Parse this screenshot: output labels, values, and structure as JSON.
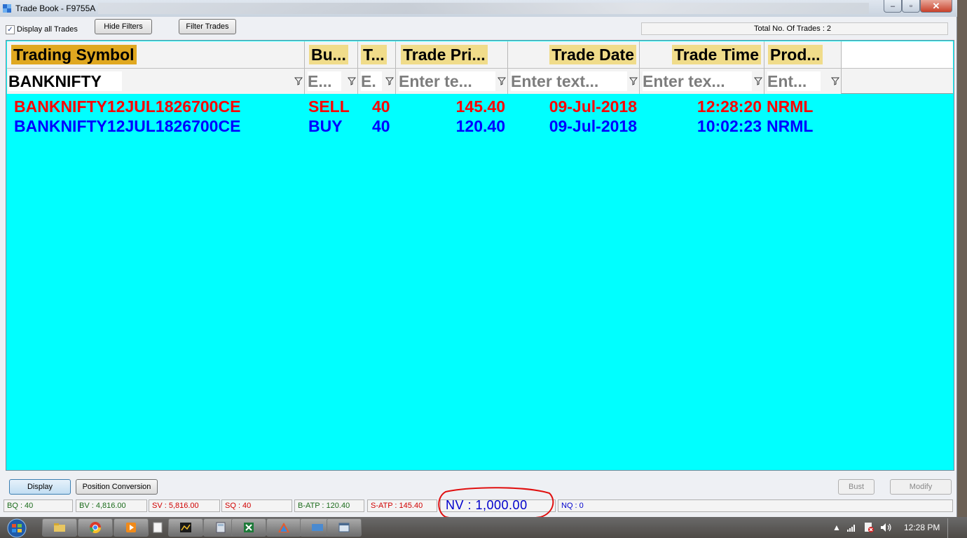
{
  "window": {
    "title": "Trade Book - F9755A",
    "minimize_glyph": "–",
    "maximize_glyph": "▫",
    "close_glyph": "✕"
  },
  "toolbar": {
    "display_all_checked": true,
    "display_all_label": "Display all Trades",
    "hide_filters_label": "Hide Filters",
    "filter_trades_label": "Filter Trades",
    "total_trades_text": "Total No. Of Trades : 2"
  },
  "grid": {
    "columns": [
      {
        "header": "Trading Symbol",
        "filter_value": "BANKNIFTY",
        "filter_placeholder": ""
      },
      {
        "header": "Bu...",
        "filter_value": "",
        "filter_placeholder": "E..."
      },
      {
        "header": "T...",
        "filter_value": "",
        "filter_placeholder": "E."
      },
      {
        "header": "Trade Pri...",
        "filter_value": "",
        "filter_placeholder": "Enter te..."
      },
      {
        "header": "Trade Date",
        "filter_value": "",
        "filter_placeholder": "Enter text..."
      },
      {
        "header": "Trade Time",
        "filter_value": "",
        "filter_placeholder": "Enter tex..."
      },
      {
        "header": "Prod...",
        "filter_value": "",
        "filter_placeholder": "Ent..."
      }
    ],
    "rows": [
      {
        "symbol": "BANKNIFTY12JUL1826700CE",
        "side": "SELL",
        "qty": "40",
        "price": "145.40",
        "date": "09-Jul-2018",
        "time": "12:28:20",
        "product": "NRML",
        "color": "#ff0000"
      },
      {
        "symbol": "BANKNIFTY12JUL1826700CE",
        "side": "BUY",
        "qty": "40",
        "price": "120.40",
        "date": "09-Jul-2018",
        "time": "10:02:23",
        "product": "NRML",
        "color": "#0000ff"
      }
    ],
    "background": "#00ffff",
    "header_highlight": "#f0dc8a"
  },
  "actions": {
    "display_label": "Display",
    "position_conversion_label": "Position Conversion",
    "bust_label": "Bust",
    "modify_label": "Modify"
  },
  "summary": {
    "bq": "BQ : 40",
    "bv": "BV : 4,816.00",
    "sv": "SV : 5,816.00",
    "sq": "SQ : 40",
    "b_atp": "B-ATP : 120.40",
    "s_atp": "S-ATP : 145.40",
    "nv": "NV : 1,000.00",
    "nq": "NQ : 0"
  },
  "taskbar": {
    "clock": "12:28 PM",
    "apps": [
      "start-orb",
      "file-explorer",
      "chrome",
      "media-player",
      "notepad",
      "trading-terminal",
      "calculator",
      "excel",
      "network-app",
      "remote-app",
      "window-app"
    ]
  }
}
